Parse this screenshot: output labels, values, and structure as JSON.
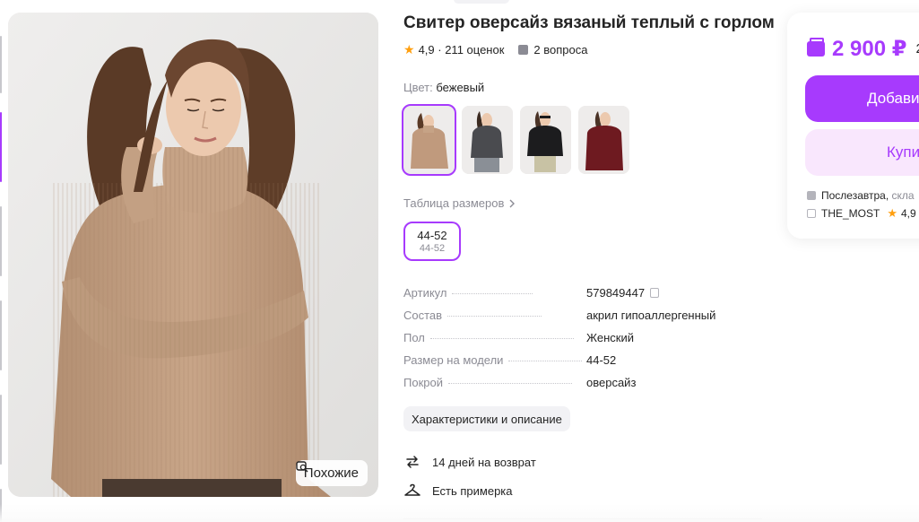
{
  "product": {
    "title": "Свитер оверсайз вязаный теплый с горлом",
    "rating": "4,9",
    "reviews": "211 оценок",
    "questions": "2 вопроса"
  },
  "gallery": {
    "similar_label": "Похожие",
    "thumb_count": 6
  },
  "color": {
    "label": "Цвет:",
    "value": "бежевый",
    "swatches": [
      {
        "name": "beige",
        "hex": "#c09a7d"
      },
      {
        "name": "graphite",
        "hex": "#4a4b4f"
      },
      {
        "name": "black",
        "hex": "#1c1c1e"
      },
      {
        "name": "burgundy",
        "hex": "#6e1a20"
      }
    ]
  },
  "sizes": {
    "table_link": "Таблица размеров",
    "selected_main": "44-52",
    "selected_sub": "44-52"
  },
  "params": [
    {
      "key": "Артикул",
      "value": "579849447"
    },
    {
      "key": "Состав",
      "value": "акрил гипоаллергенный"
    },
    {
      "key": "Пол",
      "value": "Женский"
    },
    {
      "key": "Размер на модели",
      "value": "44-52"
    },
    {
      "key": "Покрой",
      "value": "оверсайз"
    }
  ],
  "chars_button": "Характеристики и описание",
  "perks": {
    "return": "14 дней на возврат",
    "fitting": "Есть примерка"
  },
  "buy_card": {
    "price": "2 900 ₽",
    "old_price_fragment": "2",
    "add_to_cart": "Добави",
    "buy_now": "Купи",
    "delivery_when": "Послезавтра,",
    "delivery_where": "скла",
    "seller_name": "THE_MOST",
    "seller_rating": "4,9"
  },
  "colors": {
    "accent": "#a73afd",
    "accent_light": "#f9e7fd",
    "star": "#ff9f0f",
    "muted_text": "#8b8b94",
    "sweater": "#c4a185"
  }
}
